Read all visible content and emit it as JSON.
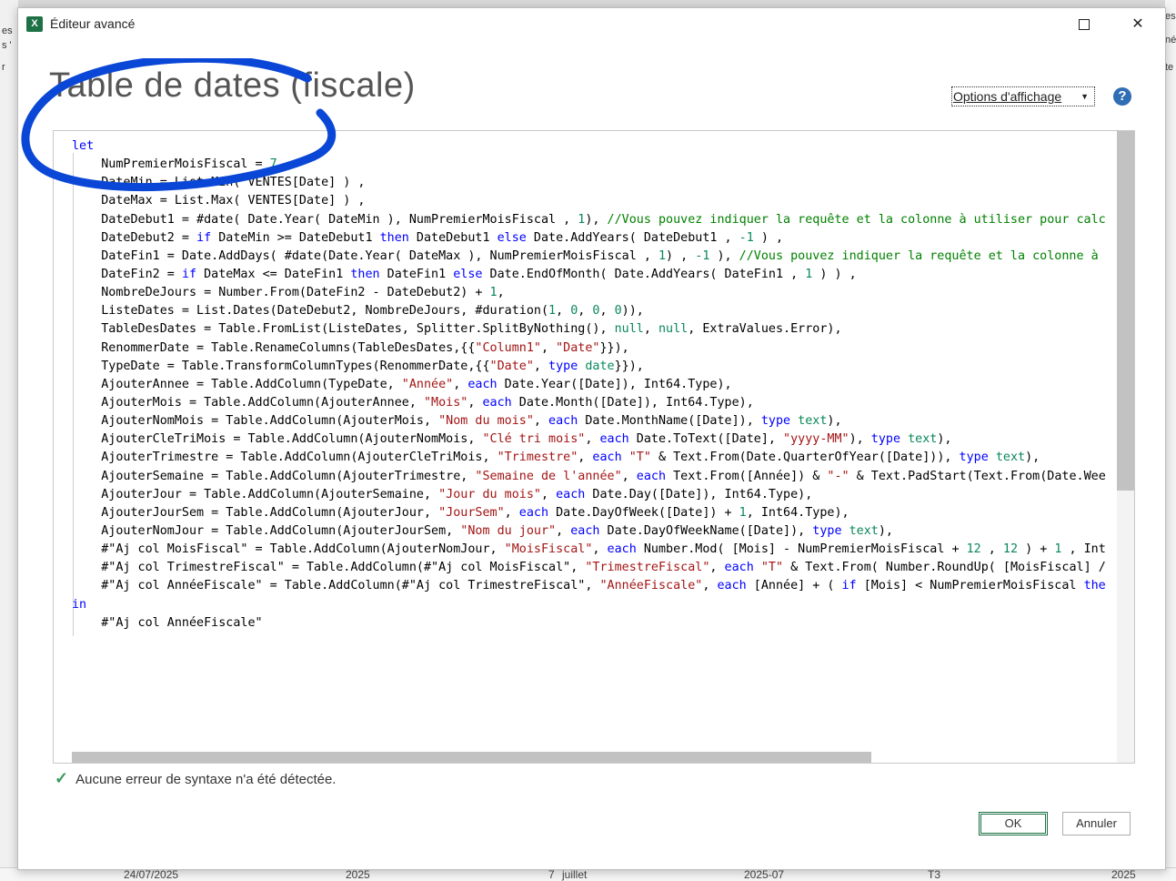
{
  "background": {
    "left_fragments": [
      "es",
      "s '",
      "r"
    ],
    "right_fragments": [
      "es",
      "né",
      "te"
    ],
    "bottom_cells": [
      "24/07/2025",
      "2025",
      "7",
      "juillet",
      "2025-07",
      "T3",
      "2025"
    ]
  },
  "window": {
    "icon_letter": "X",
    "title": "Éditeur avancé",
    "minimize": "—",
    "close": "✕"
  },
  "query_title": "Table de dates (fiscale)",
  "options": {
    "label": "Options d'affichage",
    "caret": "▼"
  },
  "help": "?",
  "code_lines": [
    [
      [
        "k",
        "let"
      ]
    ],
    [
      [
        "t",
        "    NumPremierMoisFiscal = "
      ],
      [
        "n",
        "7"
      ],
      [
        "t",
        " ,"
      ]
    ],
    [
      [
        "t",
        "    DateMin = List.Min( VENTES[Date] ) ,"
      ]
    ],
    [
      [
        "t",
        "    DateMax = List.Max( VENTES[Date] ) ,"
      ]
    ],
    [
      [
        "t",
        "    DateDebut1 = #date( Date.Year( DateMin ), NumPremierMoisFiscal , "
      ],
      [
        "n",
        "1"
      ],
      [
        "t",
        "), "
      ],
      [
        "c",
        "//Vous pouvez indiquer la requête et la colonne à utiliser pour calc"
      ]
    ],
    [
      [
        "t",
        "    DateDebut2 = "
      ],
      [
        "k",
        "if"
      ],
      [
        "t",
        " DateMin >= DateDebut1 "
      ],
      [
        "k",
        "then"
      ],
      [
        "t",
        " DateDebut1 "
      ],
      [
        "k",
        "else"
      ],
      [
        "t",
        " Date.AddYears( DateDebut1 , "
      ],
      [
        "n",
        "-1"
      ],
      [
        "t",
        " ) ,"
      ]
    ],
    [
      [
        "t",
        "    DateFin1 = Date.AddDays( #date(Date.Year( DateMax ), NumPremierMoisFiscal , "
      ],
      [
        "n",
        "1"
      ],
      [
        "t",
        ") , "
      ],
      [
        "n",
        "-1"
      ],
      [
        "t",
        " ), "
      ],
      [
        "c",
        "//Vous pouvez indiquer la requête et la colonne à"
      ]
    ],
    [
      [
        "t",
        "    DateFin2 = "
      ],
      [
        "k",
        "if"
      ],
      [
        "t",
        " DateMax <= DateFin1 "
      ],
      [
        "k",
        "then"
      ],
      [
        "t",
        " DateFin1 "
      ],
      [
        "k",
        "else"
      ],
      [
        "t",
        " Date.EndOfMonth( Date.AddYears( DateFin1 , "
      ],
      [
        "n",
        "1"
      ],
      [
        "t",
        " ) ) ,"
      ]
    ],
    [
      [
        "t",
        "    NombreDeJours = Number.From(DateFin2 - DateDebut2) + "
      ],
      [
        "n",
        "1"
      ],
      [
        "t",
        ","
      ]
    ],
    [
      [
        "t",
        "    ListeDates = List.Dates(DateDebut2, NombreDeJours, #duration("
      ],
      [
        "n",
        "1"
      ],
      [
        "t",
        ", "
      ],
      [
        "n",
        "0"
      ],
      [
        "t",
        ", "
      ],
      [
        "n",
        "0"
      ],
      [
        "t",
        ", "
      ],
      [
        "n",
        "0"
      ],
      [
        "t",
        ")),"
      ]
    ],
    [
      [
        "t",
        "    TableDesDates = Table.FromList(ListeDates, Splitter.SplitByNothing(), "
      ],
      [
        "n",
        "null"
      ],
      [
        "t",
        ", "
      ],
      [
        "n",
        "null"
      ],
      [
        "t",
        ", ExtraValues.Error),"
      ]
    ],
    [
      [
        "t",
        "    RenommerDate = Table.RenameColumns(TableDesDates,{{"
      ],
      [
        "s",
        "\"Column1\""
      ],
      [
        "t",
        ", "
      ],
      [
        "s",
        "\"Date\""
      ],
      [
        "t",
        "}}),"
      ]
    ],
    [
      [
        "t",
        "    TypeDate = Table.TransformColumnTypes(RenommerDate,{{"
      ],
      [
        "s",
        "\"Date\""
      ],
      [
        "t",
        ", "
      ],
      [
        "k",
        "type"
      ],
      [
        "t",
        " "
      ],
      [
        "n",
        "date"
      ],
      [
        "t",
        "}}),"
      ]
    ],
    [
      [
        "t",
        "    AjouterAnnee = Table.AddColumn(TypeDate, "
      ],
      [
        "s",
        "\"Année\""
      ],
      [
        "t",
        ", "
      ],
      [
        "k",
        "each"
      ],
      [
        "t",
        " Date.Year([Date]), Int64.Type),"
      ]
    ],
    [
      [
        "t",
        "    AjouterMois = Table.AddColumn(AjouterAnnee, "
      ],
      [
        "s",
        "\"Mois\""
      ],
      [
        "t",
        ", "
      ],
      [
        "k",
        "each"
      ],
      [
        "t",
        " Date.Month([Date]), Int64.Type),"
      ]
    ],
    [
      [
        "t",
        "    AjouterNomMois = Table.AddColumn(AjouterMois, "
      ],
      [
        "s",
        "\"Nom du mois\""
      ],
      [
        "t",
        ", "
      ],
      [
        "k",
        "each"
      ],
      [
        "t",
        " Date.MonthName([Date]), "
      ],
      [
        "k",
        "type"
      ],
      [
        "t",
        " "
      ],
      [
        "n",
        "text"
      ],
      [
        "t",
        "),"
      ]
    ],
    [
      [
        "t",
        "    AjouterCleTriMois = Table.AddColumn(AjouterNomMois, "
      ],
      [
        "s",
        "\"Clé tri mois\""
      ],
      [
        "t",
        ", "
      ],
      [
        "k",
        "each"
      ],
      [
        "t",
        " Date.ToText([Date], "
      ],
      [
        "s",
        "\"yyyy-MM\""
      ],
      [
        "t",
        "), "
      ],
      [
        "k",
        "type"
      ],
      [
        "t",
        " "
      ],
      [
        "n",
        "text"
      ],
      [
        "t",
        "),"
      ]
    ],
    [
      [
        "t",
        "    AjouterTrimestre = Table.AddColumn(AjouterCleTriMois, "
      ],
      [
        "s",
        "\"Trimestre\""
      ],
      [
        "t",
        ", "
      ],
      [
        "k",
        "each"
      ],
      [
        "t",
        " "
      ],
      [
        "s",
        "\"T\""
      ],
      [
        "t",
        " & Text.From(Date.QuarterOfYear([Date])), "
      ],
      [
        "k",
        "type"
      ],
      [
        "t",
        " "
      ],
      [
        "n",
        "text"
      ],
      [
        "t",
        "),"
      ]
    ],
    [
      [
        "t",
        "    AjouterSemaine = Table.AddColumn(AjouterTrimestre, "
      ],
      [
        "s",
        "\"Semaine de l'année\""
      ],
      [
        "t",
        ", "
      ],
      [
        "k",
        "each"
      ],
      [
        "t",
        " Text.From([Année]) & "
      ],
      [
        "s",
        "\"-\""
      ],
      [
        "t",
        " & Text.PadStart(Text.From(Date.Wee"
      ]
    ],
    [
      [
        "t",
        "    AjouterJour = Table.AddColumn(AjouterSemaine, "
      ],
      [
        "s",
        "\"Jour du mois\""
      ],
      [
        "t",
        ", "
      ],
      [
        "k",
        "each"
      ],
      [
        "t",
        " Date.Day([Date]), Int64.Type),"
      ]
    ],
    [
      [
        "t",
        "    AjouterJourSem = Table.AddColumn(AjouterJour, "
      ],
      [
        "s",
        "\"JourSem\""
      ],
      [
        "t",
        ", "
      ],
      [
        "k",
        "each"
      ],
      [
        "t",
        " Date.DayOfWeek([Date]) + "
      ],
      [
        "n",
        "1"
      ],
      [
        "t",
        ", Int64.Type),"
      ]
    ],
    [
      [
        "t",
        "    AjouterNomJour = Table.AddColumn(AjouterJourSem, "
      ],
      [
        "s",
        "\"Nom du jour\""
      ],
      [
        "t",
        ", "
      ],
      [
        "k",
        "each"
      ],
      [
        "t",
        " Date.DayOfWeekName([Date]), "
      ],
      [
        "k",
        "type"
      ],
      [
        "t",
        " "
      ],
      [
        "n",
        "text"
      ],
      [
        "t",
        "),"
      ]
    ],
    [
      [
        "t",
        "    #\"Aj col MoisFiscal\" = Table.AddColumn(AjouterNomJour, "
      ],
      [
        "s",
        "\"MoisFiscal\""
      ],
      [
        "t",
        ", "
      ],
      [
        "k",
        "each"
      ],
      [
        "t",
        " Number.Mod( [Mois] - NumPremierMoisFiscal + "
      ],
      [
        "n",
        "12"
      ],
      [
        "t",
        " , "
      ],
      [
        "n",
        "12"
      ],
      [
        "t",
        " ) + "
      ],
      [
        "n",
        "1"
      ],
      [
        "t",
        " , Int"
      ]
    ],
    [
      [
        "t",
        "    #\"Aj col TrimestreFiscal\" = Table.AddColumn(#\"Aj col MoisFiscal\", "
      ],
      [
        "s",
        "\"TrimestreFiscal\""
      ],
      [
        "t",
        ", "
      ],
      [
        "k",
        "each"
      ],
      [
        "t",
        " "
      ],
      [
        "s",
        "\"T\""
      ],
      [
        "t",
        " & Text.From( Number.RoundUp( [MoisFiscal] /"
      ]
    ],
    [
      [
        "t",
        "    #\"Aj col AnnéeFiscale\" = Table.AddColumn(#\"Aj col TrimestreFiscal\", "
      ],
      [
        "s",
        "\"AnnéeFiscale\""
      ],
      [
        "t",
        ", "
      ],
      [
        "k",
        "each"
      ],
      [
        "t",
        " [Année] + ( "
      ],
      [
        "k",
        "if"
      ],
      [
        "t",
        " [Mois] < NumPremierMoisFiscal "
      ],
      [
        "k",
        "the"
      ]
    ],
    [
      [
        "k",
        "in"
      ]
    ],
    [
      [
        "t",
        "    #\"Aj col AnnéeFiscale\""
      ]
    ]
  ],
  "status": {
    "icon": "check-icon",
    "text": "Aucune erreur de syntaxe n'a été détectée."
  },
  "buttons": {
    "ok": "OK",
    "cancel": "Annuler"
  },
  "colors": {
    "keyword": "#0000ff",
    "string": "#a31515",
    "number": "#09885a",
    "comment": "#008000",
    "annotation": "#0a47d6",
    "excel_green": "#1e7145"
  }
}
